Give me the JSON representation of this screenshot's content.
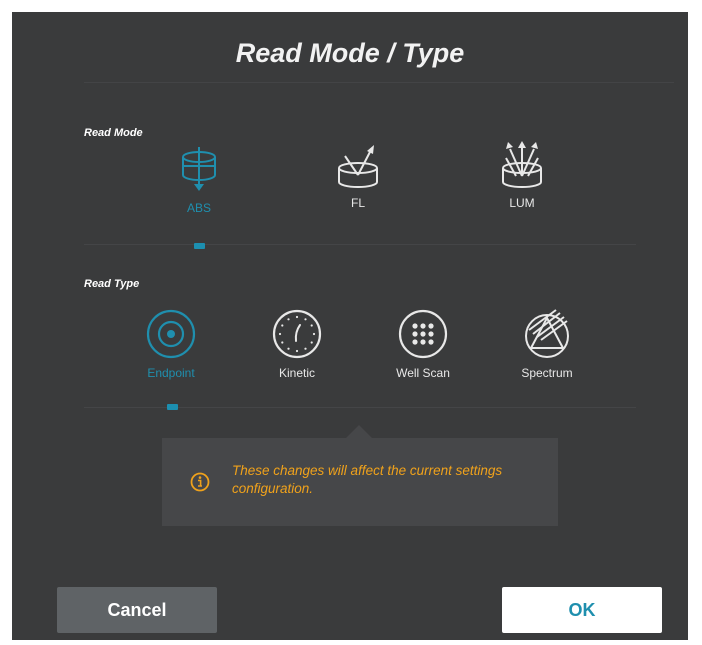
{
  "dialog": {
    "title": "Read Mode / Type"
  },
  "read_mode": {
    "label": "Read Mode",
    "selected": "ABS",
    "options": [
      {
        "label": "ABS",
        "icon": "absorbance-icon"
      },
      {
        "label": "FL",
        "icon": "fluorescence-icon"
      },
      {
        "label": "LUM",
        "icon": "luminescence-icon"
      }
    ]
  },
  "read_type": {
    "label": "Read Type",
    "selected": "Endpoint",
    "options": [
      {
        "label": "Endpoint",
        "icon": "endpoint-icon"
      },
      {
        "label": "Kinetic",
        "icon": "kinetic-clock-icon"
      },
      {
        "label": "Well Scan",
        "icon": "well-scan-grid-icon"
      },
      {
        "label": "Spectrum",
        "icon": "spectrum-icon"
      }
    ]
  },
  "info": {
    "icon": "info-icon",
    "message": "These changes will affect the current settings configuration."
  },
  "buttons": {
    "cancel": "Cancel",
    "ok": "OK"
  },
  "colors": {
    "background": "#3a3b3c",
    "accent": "#1f8fae",
    "warning": "#f0a21b",
    "cancel_button": "#5f6366",
    "ok_button": "#ffffff"
  }
}
